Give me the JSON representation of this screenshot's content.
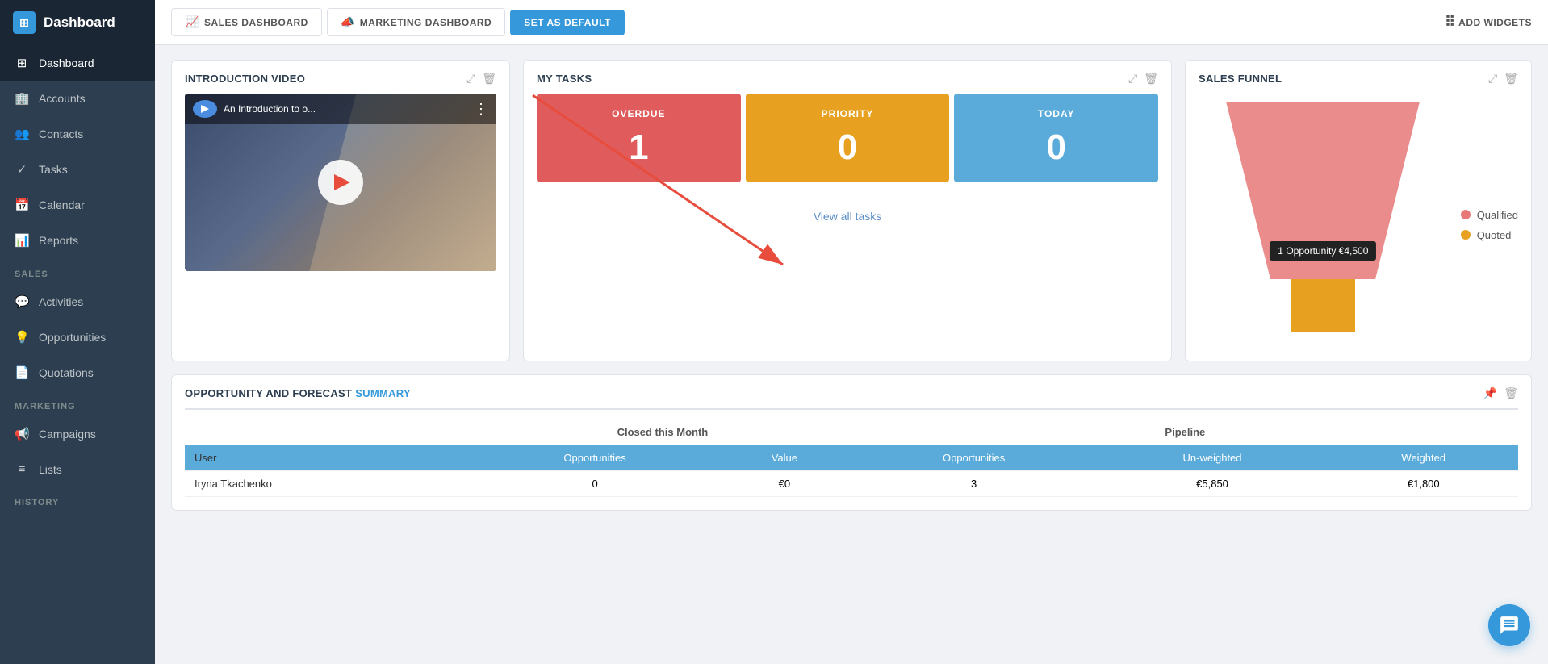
{
  "sidebar": {
    "title": "Dashboard",
    "items": [
      {
        "id": "dashboard",
        "label": "Dashboard",
        "icon": "⊞",
        "active": true,
        "section": null
      },
      {
        "id": "accounts",
        "label": "Accounts",
        "icon": "🏢",
        "active": false,
        "section": null
      },
      {
        "id": "contacts",
        "label": "Contacts",
        "icon": "👥",
        "active": false,
        "section": null
      },
      {
        "id": "tasks",
        "label": "Tasks",
        "icon": "✓",
        "active": false,
        "section": null
      },
      {
        "id": "calendar",
        "label": "Calendar",
        "icon": "📅",
        "active": false,
        "section": null
      },
      {
        "id": "reports",
        "label": "Reports",
        "icon": "📊",
        "active": false,
        "section": null
      },
      {
        "id": "activities",
        "label": "Activities",
        "icon": "💬",
        "active": false,
        "section": "SALES"
      },
      {
        "id": "opportunities",
        "label": "Opportunities",
        "icon": "💡",
        "active": false,
        "section": null
      },
      {
        "id": "quotations",
        "label": "Quotations",
        "icon": "📄",
        "active": false,
        "section": null
      },
      {
        "id": "campaigns",
        "label": "Campaigns",
        "icon": "📢",
        "active": false,
        "section": "MARKETING"
      },
      {
        "id": "lists",
        "label": "Lists",
        "icon": "≡",
        "active": false,
        "section": null
      }
    ],
    "history_section": "HISTORY"
  },
  "topbar": {
    "tabs": [
      {
        "id": "sales-dashboard",
        "label": "SALES DASHBOARD",
        "icon": "📈",
        "active": false
      },
      {
        "id": "marketing-dashboard",
        "label": "MARKETING DASHBOARD",
        "icon": "📣",
        "active": false
      }
    ],
    "set_default_label": "SET AS DEFAULT",
    "add_widgets_label": "ADD WIDGETS"
  },
  "widgets": {
    "intro_video": {
      "title": "INTRODUCTION VIDEO",
      "video_title": "An Introduction to o...",
      "expand_icon": "↗",
      "delete_icon": "🗑"
    },
    "my_tasks": {
      "title": "MY TASKS",
      "overdue_label": "OVERDUE",
      "overdue_count": "1",
      "priority_label": "PRIORITY",
      "priority_count": "0",
      "today_label": "TODAY",
      "today_count": "0",
      "view_all_label": "View all tasks",
      "expand_icon": "↗",
      "delete_icon": "🗑"
    },
    "sales_funnel": {
      "title": "SALES FUNNEL",
      "expand_icon": "↗",
      "delete_icon": "🗑",
      "legend": [
        {
          "id": "qualified",
          "label": "Qualified",
          "color": "#e87878"
        },
        {
          "id": "quoted",
          "label": "Quoted",
          "color": "#e8a020"
        }
      ],
      "tooltip": "1 Opportunity €4,500"
    },
    "forecast_summary": {
      "title": "OPPORTUNITY AND FORECAST SUMMARY",
      "expand_icon": "↗",
      "delete_icon": "🗑",
      "groups": [
        {
          "label": "Closed this Month",
          "colspan": 2,
          "cols": [
            "Opportunities",
            "Value"
          ]
        },
        {
          "label": "Pipeline",
          "colspan": 3,
          "cols": [
            "Opportunities",
            "Un-weighted",
            "Weighted"
          ]
        }
      ],
      "row_header": "User",
      "rows": [
        {
          "user": "Iryna Tkachenko",
          "closed_opps": "0",
          "closed_value": "€0",
          "pipeline_opps": "3",
          "unweighted": "€5,850",
          "weighted": "€1,800"
        }
      ]
    }
  }
}
